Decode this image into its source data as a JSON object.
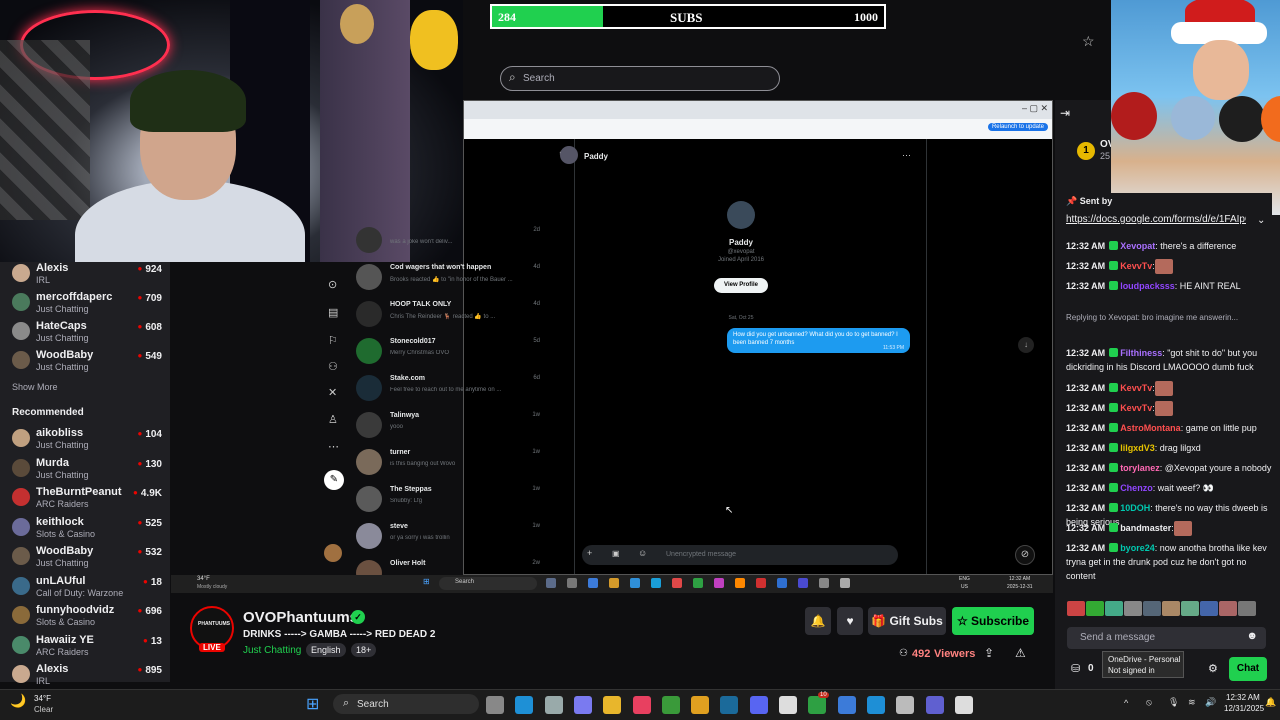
{
  "overlay": {
    "subs_current": "284",
    "subs_label": "SUBS",
    "subs_goal": "1000",
    "subs_fraction": 0.284,
    "search_placeholder": "Search"
  },
  "sidebar": {
    "followed": [
      {
        "name": "Alexis",
        "category": "IRL",
        "viewers": "924",
        "color": "#c9a98f"
      },
      {
        "name": "mercoffdaperc",
        "category": "Just Chatting",
        "viewers": "709",
        "color": "#4a7a5c"
      },
      {
        "name": "HateCaps",
        "category": "Just Chatting",
        "viewers": "608",
        "color": "#8a8a8a"
      },
      {
        "name": "WoodBaby",
        "category": "Just Chatting",
        "viewers": "549",
        "color": "#6b5b4a"
      }
    ],
    "show_more": "Show More",
    "recommended_heading": "Recommended",
    "recommended": [
      {
        "name": "aikobliss",
        "category": "Just Chatting",
        "viewers": "104",
        "color": "#c0a080"
      },
      {
        "name": "Murda",
        "category": "Just Chatting",
        "viewers": "130",
        "color": "#5a4a3a"
      },
      {
        "name": "TheBurntPeanut",
        "category": "ARC Raiders",
        "viewers": "4.9K",
        "color": "#c43030"
      },
      {
        "name": "keithlock",
        "category": "Slots & Casino",
        "viewers": "525",
        "color": "#6b6b9a"
      },
      {
        "name": "WoodBaby",
        "category": "Just Chatting",
        "viewers": "532",
        "color": "#6b5b4a"
      },
      {
        "name": "unLAUful",
        "category": "Call of Duty: Warzone",
        "viewers": "18",
        "color": "#3a6a8a"
      },
      {
        "name": "funnyhoodvidz",
        "category": "Slots & Casino",
        "viewers": "696",
        "color": "#8a6a3a"
      },
      {
        "name": "Hawaiiz YE",
        "category": "ARC Raiders",
        "viewers": "13",
        "color": "#4a8a6a"
      },
      {
        "name": "Alexis",
        "category": "IRL",
        "viewers": "895",
        "color": "#c9a98f"
      }
    ]
  },
  "share": {
    "relaunch": "Relaunch to update",
    "contact_name": "Paddy",
    "profile_name": "Paddy",
    "profile_handle": "@xevopat",
    "profile_joined": "Joined April 2016",
    "view_profile": "View Profile",
    "date": "Sat, Oct 25",
    "message": "How did you get unbanned? What did you do to get banned? I been banned 7 months",
    "message_time": "11:53 PM",
    "composer_placeholder": "Unencrypted message",
    "dms": [
      {
        "name": "",
        "msg": "was a joke won't deliv...",
        "time": "2d",
        "color": "#333"
      },
      {
        "name": "Cod wagers that won't happen",
        "msg": "Brooks reacted 👍 to \"in honor of the Bauer ...",
        "time": "4d",
        "color": "#555"
      },
      {
        "name": "HOOP TALK ONLY",
        "msg": "Chris The Reindeer 🦌 reacted 👍 to ...",
        "time": "4d",
        "color": "#2a2a2a"
      },
      {
        "name": "Stonecold017",
        "msg": "Merry Christmas OVO",
        "time": "5d",
        "color": "#1f6b2f"
      },
      {
        "name": "Stake.com",
        "msg": "Feel free to reach out to me anytime on ...",
        "time": "6d",
        "color": "#1a2c38"
      },
      {
        "name": "Talinwya",
        "msg": "yooo",
        "time": "1w",
        "color": "#3a3a3a"
      },
      {
        "name": "turner",
        "msg": "is this banging out Wovo",
        "time": "1w",
        "color": "#7a6a5a"
      },
      {
        "name": "The Steppas",
        "msg": "Snubby: Lfg",
        "time": "1w",
        "color": "#5a5a5a"
      },
      {
        "name": "steve",
        "msg": "or ya sorry i was trollin",
        "time": "1w",
        "color": "#8a8a9a"
      },
      {
        "name": "Oliver Holt",
        "msg": "",
        "time": "2w",
        "color": "#6a5040"
      }
    ],
    "inner_weather_temp": "34°F",
    "inner_weather_desc": "Mostly cloudy",
    "inner_search": "Search",
    "inner_time": "12:32 AM",
    "inner_date": "2025-12-31",
    "inner_lang": "ENG",
    "inner_region": "US"
  },
  "stream": {
    "channel": "OVOPhantuums",
    "title": "DRINKS -----> GAMBA -----> RED DEAD 2",
    "category": "Just Chatting",
    "tag_language": "English",
    "tag_age": "18+",
    "live_label": "LIVE",
    "gift_subs": "Gift Subs",
    "subscribe": "Subscribe",
    "viewers": "492",
    "viewers_label": "Viewers"
  },
  "chat": {
    "rank": "1",
    "rank_text": "OVO",
    "rank_sub": "25",
    "pinned_label": "Sent by",
    "pinned_link": "https://docs.google.com/forms/d/e/1FAIpQLSdCtPYSJqQkLJHJ2kvYFmDL5M...",
    "messages": [
      {
        "time": "12:32 AM",
        "user": "Xevopat",
        "color": "#a970ff",
        "text": ": there's a difference"
      },
      {
        "time": "12:32 AM",
        "user": "KevvTv",
        "color": "#ff4f4f",
        "text": ":"
      },
      {
        "time": "12:32 AM",
        "user": "loudpacksss",
        "color": "#9146ff",
        "text": ": HE AINT REAL"
      },
      {
        "time": "",
        "user": "",
        "color": "#adadb8",
        "text": "Replying to Xevopat: bro imagine me answerin..."
      },
      {
        "time": "12:32 AM",
        "user": "Filthiness",
        "color": "#a970ff",
        "text": ": \"got shit to do\" but you dickriding in his Discord LMAOOOO dumb fuck"
      },
      {
        "time": "12:32 AM",
        "user": "KevvTv",
        "color": "#ff4f4f",
        "text": ":"
      },
      {
        "time": "12:32 AM",
        "user": "KevvTv",
        "color": "#ff4f4f",
        "text": ":"
      },
      {
        "time": "12:32 AM",
        "user": "AstroMontana",
        "color": "#ff4f4f",
        "text": ": game on little pup"
      },
      {
        "time": "12:32 AM",
        "user": "lilgxdV3",
        "color": "#e6c300",
        "text": ": drag lilgxd"
      },
      {
        "time": "12:32 AM",
        "user": "torylanez",
        "color": "#ff69b4",
        "text": ": @Xevopat youre a nobody"
      },
      {
        "time": "12:32 AM",
        "user": "Chenzo",
        "color": "#9146ff",
        "text": ": wait weef? 👀"
      },
      {
        "time": "12:32 AM",
        "user": "10DOH",
        "color": "#00c8af",
        "text": ": there's no way this dweeb is being serious"
      },
      {
        "time": "12:32 AM",
        "user": "bandmaster",
        "color": "#efeff1",
        "text": ":"
      },
      {
        "time": "12:32 AM",
        "user": "byore24",
        "color": "#00c8af",
        "text": ": now anotha brotha like kev tryna get in the drunk pod cuz he don't got no content"
      }
    ],
    "input_placeholder": "Send a message",
    "points": "0",
    "chat_button": "Chat",
    "tooltip_line1": "OneDrive - Personal",
    "tooltip_line2": "Not signed in"
  },
  "taskbar": {
    "temp": "34°F",
    "weather": "Clear",
    "search": "Search",
    "time": "12:32 AM",
    "date": "12/31/2025",
    "notif_badge": "10"
  }
}
